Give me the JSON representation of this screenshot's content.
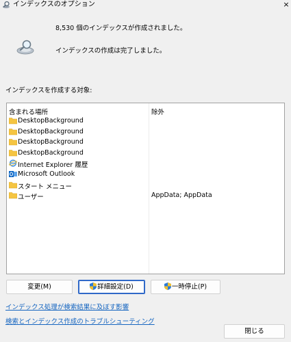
{
  "window": {
    "title": "インデックスのオプション",
    "close_label": "×"
  },
  "summary": {
    "count_text": "8,530 個のインデックスが作成されました。",
    "complete_text": "インデックスの作成は完了しました。"
  },
  "section_label": "インデックスを作成する対象:",
  "table": {
    "columns": [
      "含まれる場所",
      "除外"
    ],
    "rows": [
      {
        "icon": "folder-icon",
        "name": "DesktopBackground",
        "exclude": ""
      },
      {
        "icon": "folder-icon",
        "name": "DesktopBackground",
        "exclude": ""
      },
      {
        "icon": "folder-icon",
        "name": "DesktopBackground",
        "exclude": ""
      },
      {
        "icon": "folder-icon",
        "name": "DesktopBackground",
        "exclude": ""
      },
      {
        "icon": "internet-explorer-icon",
        "name": "Internet Explorer 履歴",
        "exclude": ""
      },
      {
        "icon": "outlook-icon",
        "name": "Microsoft Outlook",
        "exclude": ""
      },
      {
        "icon": "folder-icon",
        "name": "スタート メニュー",
        "exclude": ""
      },
      {
        "icon": "folder-icon",
        "name": "ユーザー",
        "exclude": "AppData; AppData"
      }
    ]
  },
  "buttons": {
    "modify": "変更(M)",
    "advanced": "詳細設定(D)",
    "pause": "一時停止(P)",
    "close": "閉じる"
  },
  "links": {
    "search_effect": "インデックス処理が検索結果に及ぼす影響",
    "troubleshoot": "検索とインデックス作成のトラブルシューティング"
  },
  "colors": {
    "folder": "#f5c542",
    "link": "#1565c0",
    "focus_border": "#2f68c8",
    "outlook": "#0a64c2",
    "ie": "#3a8ee6"
  }
}
